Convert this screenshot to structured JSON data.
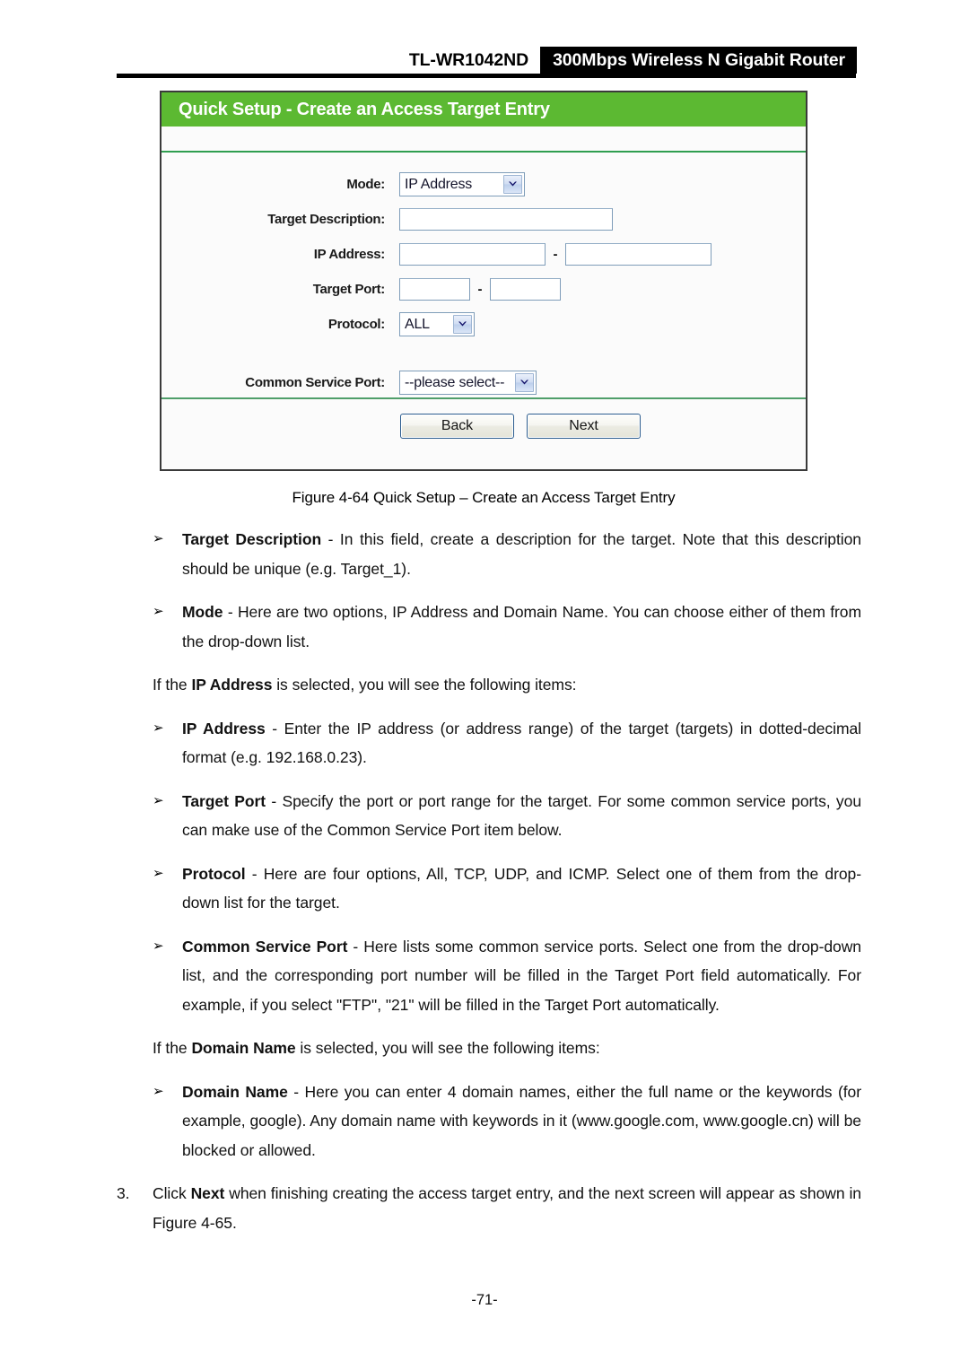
{
  "header": {
    "model": "TL-WR1042ND",
    "product": "300Mbps Wireless N Gigabit Router"
  },
  "router_ui": {
    "title": "Quick Setup - Create an Access Target Entry",
    "accent_green": "#5cb932",
    "divider_green": "#2f9e4f",
    "fields": {
      "mode": {
        "label": "Mode:",
        "selected": "IP Address",
        "options": [
          "IP Address",
          "Domain Name"
        ]
      },
      "target_description": {
        "label": "Target Description:",
        "value": "",
        "placeholder": ""
      },
      "ip_address": {
        "label": "IP Address:",
        "start_value": "",
        "end_value": "",
        "separator": "-"
      },
      "target_port": {
        "label": "Target Port:",
        "start_value": "",
        "end_value": "",
        "separator": "-"
      },
      "protocol": {
        "label": "Protocol:",
        "selected": "ALL",
        "options": [
          "ALL",
          "TCP",
          "UDP",
          "ICMP"
        ]
      },
      "common_service_port": {
        "label": "Common Service Port:",
        "selected": "--please select--",
        "options": [
          "--please select--"
        ]
      }
    },
    "buttons": {
      "back": "Back",
      "next": "Next"
    }
  },
  "figure": {
    "caption": "Figure 4-64    Quick Setup – Create an Access Target Entry"
  },
  "body": {
    "bullet_marker": "➢",
    "items": [
      {
        "kind": "bullet",
        "term": "Target Description",
        "rest": " - In this field, create a description for the target. Note that this description should be unique (e.g. Target_1)."
      },
      {
        "kind": "bullet",
        "term": "Mode",
        "rest": " - Here are two options, IP Address and Domain Name. You can choose either of them from the drop-down list."
      },
      {
        "kind": "plain",
        "pre": "If the ",
        "term": "IP Address",
        "rest": " is selected, you will see the following items:"
      },
      {
        "kind": "bullet",
        "term": "IP Address",
        "rest": " - Enter the IP address (or address range) of the target (targets) in dotted-decimal format (e.g. 192.168.0.23)."
      },
      {
        "kind": "bullet",
        "term": "Target Port",
        "rest": " - Specify the port or port range for the target. For some common service ports, you can make use of the Common Service Port item below."
      },
      {
        "kind": "bullet",
        "term": "Protocol",
        "rest": " - Here are four options, All, TCP, UDP, and ICMP. Select one of them from the drop-down list for the target."
      },
      {
        "kind": "bullet",
        "term": "Common Service Port",
        "rest": " - Here lists some common service ports. Select one from the drop-down list, and the corresponding port number will be filled in the Target Port field automatically. For example, if you select \"FTP\", \"21\" will be filled in the Target Port automatically."
      },
      {
        "kind": "plain",
        "pre": "If the ",
        "term": "Domain Name",
        "rest": " is selected, you will see the following items:"
      },
      {
        "kind": "bullet",
        "term": "Domain Name",
        "rest": " - Here you can enter 4 domain names, either the full name or the keywords (for example, google). Any domain name with keywords in it (www.google.com, www.google.cn) will be blocked or allowed."
      },
      {
        "kind": "numbered",
        "number": "3.",
        "pre": "Click ",
        "term": "Next",
        "rest": " when finishing creating the access target entry, and the next screen will appear as shown in Figure 4-65."
      }
    ]
  },
  "footer": {
    "page_number": "-71-"
  }
}
